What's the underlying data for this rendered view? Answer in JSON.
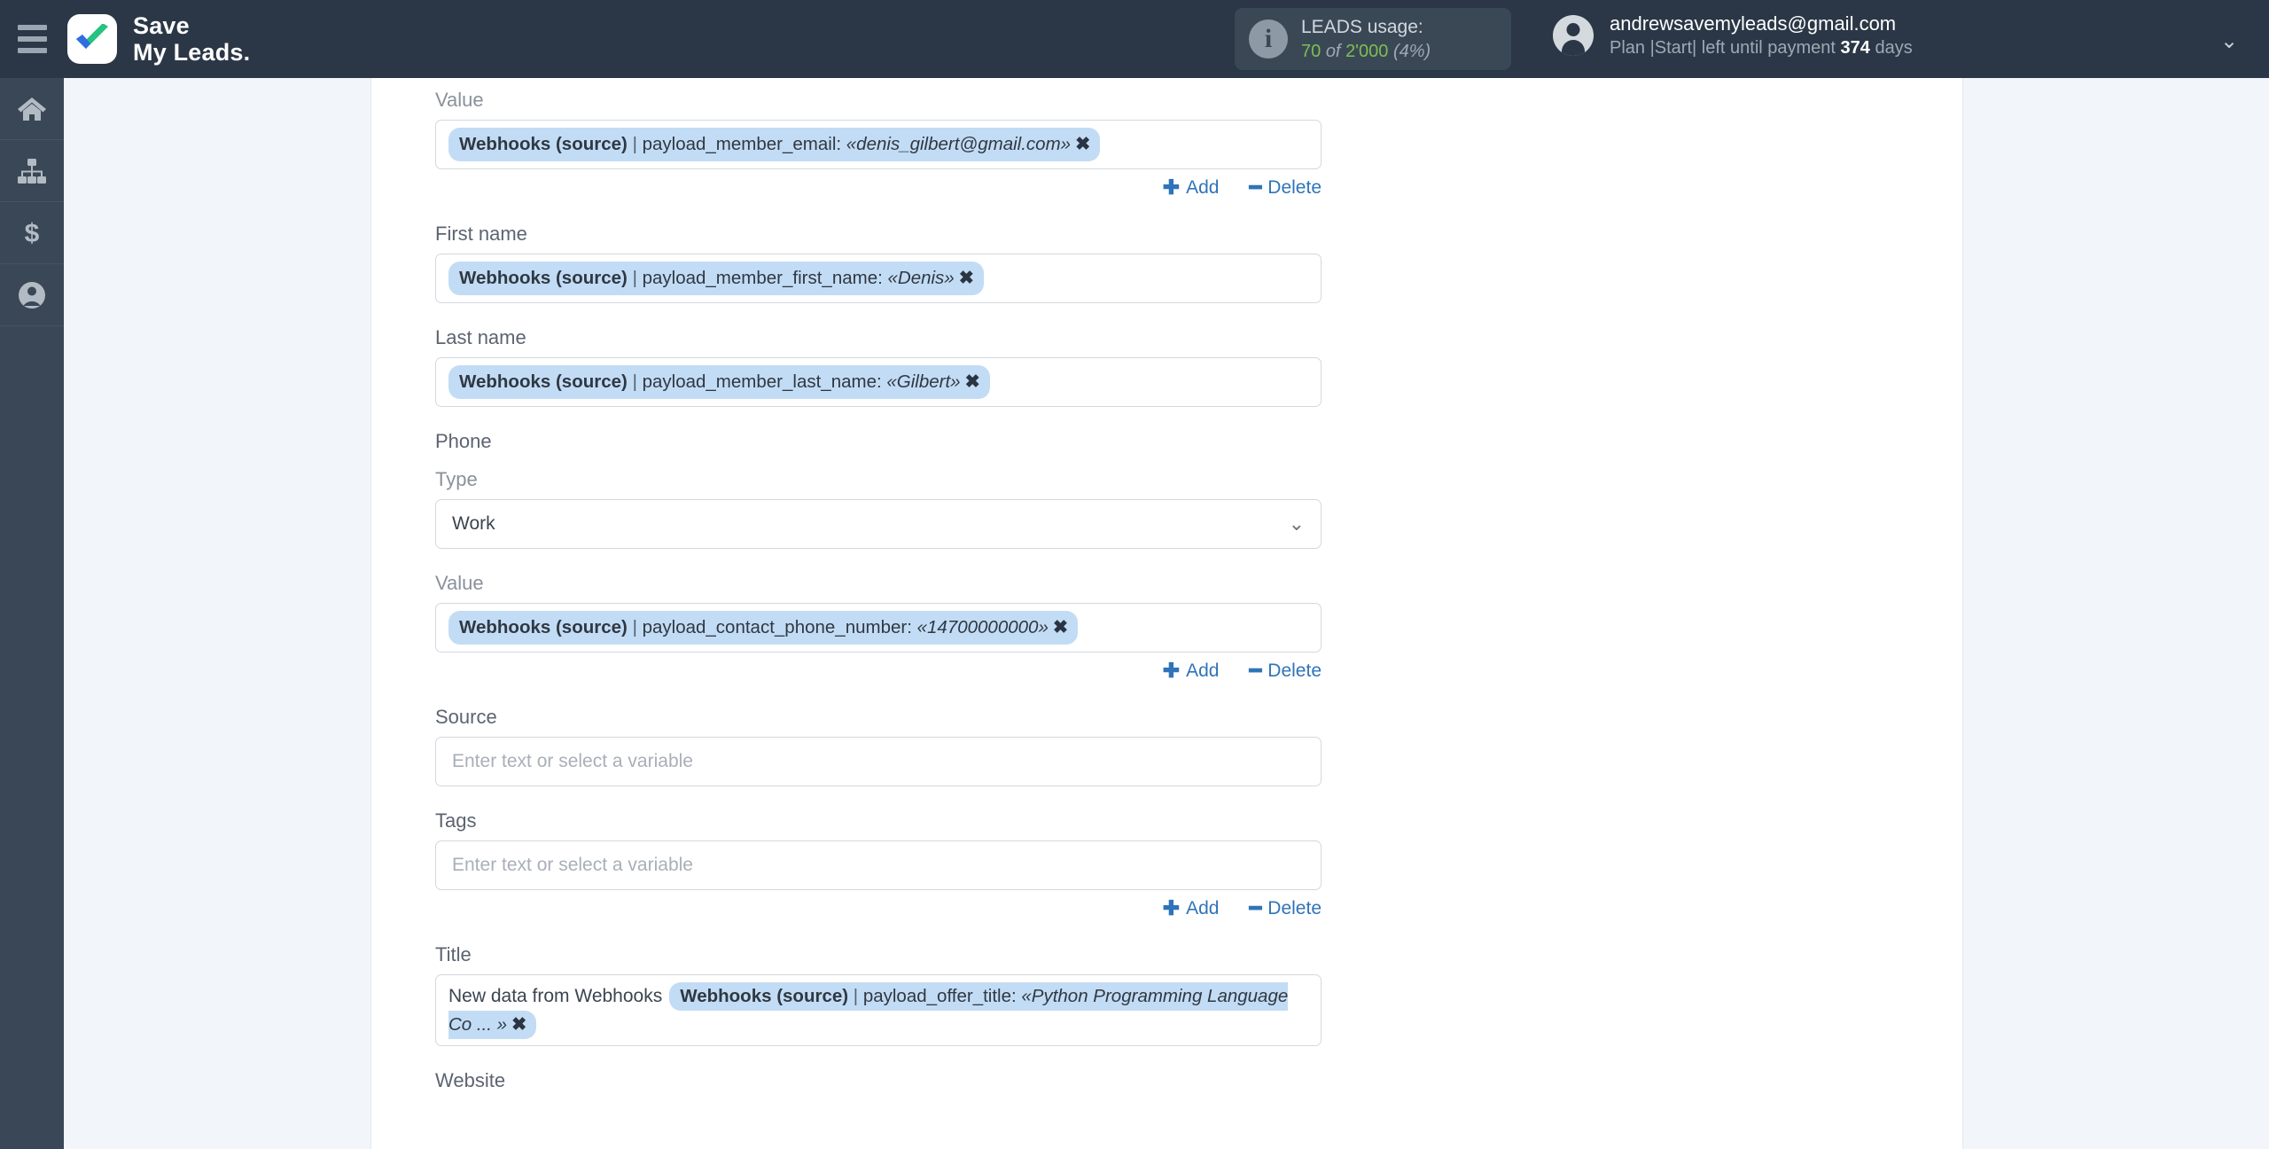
{
  "header": {
    "menu_icon": "hamburger-icon",
    "brand_line1": "Save",
    "brand_line2": "My Leads.",
    "logo_icon": "checkmark-logo-icon",
    "usage": {
      "info_icon": "info-icon",
      "title": "LEADS usage:",
      "used": "70",
      "of": "of",
      "total": "2'000",
      "percent": "(4%)"
    },
    "account": {
      "avatar_icon": "user-avatar-icon",
      "email": "andrewsavemyleads@gmail.com",
      "plan_prefix": "Plan |",
      "plan_name": "Start",
      "plan_mid": "| left until payment",
      "days": "374",
      "days_suffix": "days",
      "caret_icon": "chevron-down-icon"
    }
  },
  "sidebar": {
    "items": [
      {
        "icon": "home-icon",
        "label": "Home"
      },
      {
        "icon": "sitemap-icon",
        "label": "Connections"
      },
      {
        "icon": "dollar-icon",
        "label": "Billing"
      },
      {
        "icon": "account-icon",
        "label": "Account"
      }
    ]
  },
  "form": {
    "email_value": {
      "label": "Value",
      "tag": {
        "source": "Webhooks (source)",
        "separator": "|",
        "field": "payload_member_email:",
        "value": "«denis_gilbert@gmail.com»",
        "remove_icon": "remove-tag-icon",
        "remove_glyph": "✖"
      },
      "add_label": "Add",
      "add_symbol": "✚",
      "delete_label": "Delete",
      "delete_symbol": "━"
    },
    "first_name": {
      "label": "First name",
      "tag": {
        "source": "Webhooks (source)",
        "separator": "|",
        "field": "payload_member_first_name:",
        "value": "«Denis»",
        "remove_glyph": "✖"
      }
    },
    "last_name": {
      "label": "Last name",
      "tag": {
        "source": "Webhooks (source)",
        "separator": "|",
        "field": "payload_member_last_name:",
        "value": "«Gilbert»",
        "remove_glyph": "✖"
      }
    },
    "phone": {
      "group_label": "Phone",
      "type_label": "Type",
      "type_value": "Work",
      "type_caret": "chevron-down-icon",
      "value_label": "Value",
      "tag": {
        "source": "Webhooks (source)",
        "separator": "|",
        "field": "payload_contact_phone_number:",
        "value": "«14700000000»",
        "remove_glyph": "✖"
      },
      "add_label": "Add",
      "add_symbol": "✚",
      "delete_label": "Delete",
      "delete_symbol": "━"
    },
    "source": {
      "label": "Source",
      "placeholder": "Enter text or select a variable",
      "value": ""
    },
    "tags": {
      "label": "Tags",
      "placeholder": "Enter text or select a variable",
      "value": "",
      "add_label": "Add",
      "add_symbol": "✚",
      "delete_label": "Delete",
      "delete_symbol": "━"
    },
    "title": {
      "label": "Title",
      "static_text": "New data from Webhooks",
      "tag": {
        "source": "Webhooks (source)",
        "separator": "|",
        "field": "payload_offer_title:",
        "value": "«Python Programming Language Co ... »",
        "remove_glyph": "✖"
      }
    },
    "website": {
      "label": "Website"
    }
  },
  "colors": {
    "topbar": "#2b3746",
    "sidebar": "#394757",
    "page_bg": "#f2f5fa",
    "tag_bg": "#c3dcf5",
    "link_blue": "#2f74b8",
    "usage_green": "#7ebf4e"
  }
}
